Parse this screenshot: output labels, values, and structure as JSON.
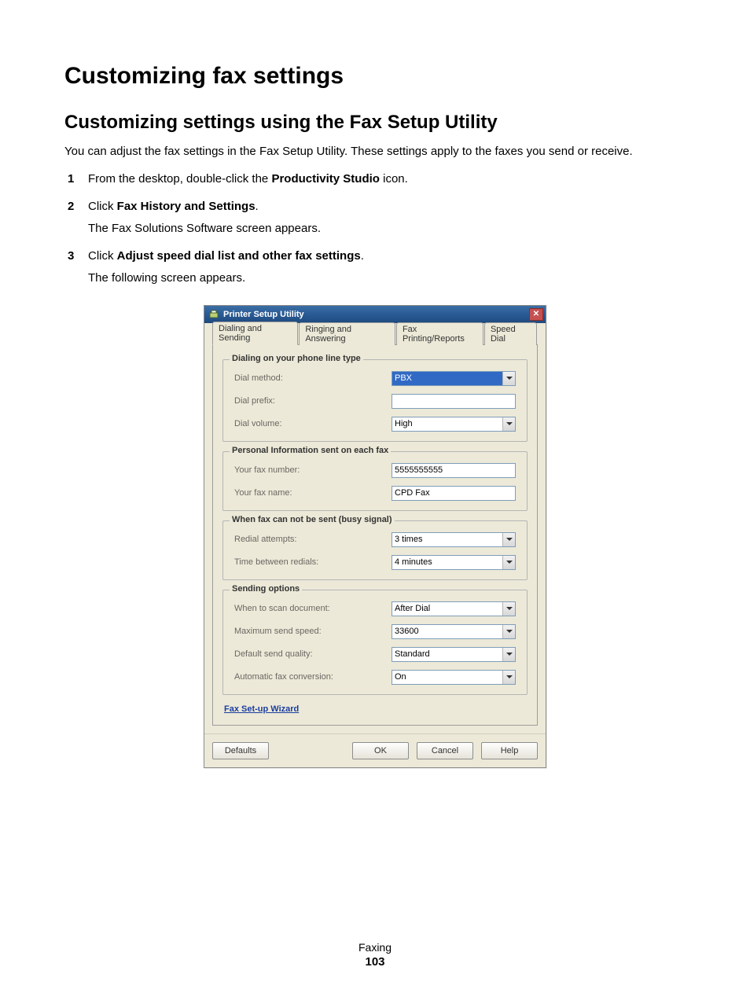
{
  "doc": {
    "heading": "Customizing fax settings",
    "subheading": "Customizing settings using the Fax Setup Utility",
    "intro": "You can adjust the fax settings in the Fax Setup Utility. These settings apply to the faxes you send or receive.",
    "steps": [
      {
        "num": "1",
        "pre": "From the desktop, double-click the ",
        "bold": "Productivity Studio",
        "post": " icon."
      },
      {
        "num": "2",
        "pre": "Click ",
        "bold": "Fax History and Settings",
        "post": ".",
        "sub": "The Fax Solutions Software screen appears."
      },
      {
        "num": "3",
        "pre": "Click ",
        "bold": "Adjust speed dial list and other fax settings",
        "post": ".",
        "sub": "The following screen appears."
      }
    ],
    "footer_label": "Faxing",
    "page_number": "103"
  },
  "dialog": {
    "title": "Printer Setup Utility",
    "tabs": [
      "Dialing and Sending",
      "Ringing and Answering",
      "Fax Printing/Reports",
      "Speed Dial"
    ],
    "groups": {
      "dialing": {
        "legend": "Dialing on your phone line type",
        "dial_method_label": "Dial method:",
        "dial_method_value": "PBX",
        "dial_prefix_label": "Dial prefix:",
        "dial_prefix_value": "",
        "dial_volume_label": "Dial volume:",
        "dial_volume_value": "High"
      },
      "personal": {
        "legend": "Personal Information sent on each fax",
        "fax_number_label": "Your fax number:",
        "fax_number_value": "5555555555",
        "fax_name_label": "Your fax name:",
        "fax_name_value": "CPD Fax"
      },
      "busy": {
        "legend": "When fax can not be sent (busy signal)",
        "redial_attempts_label": "Redial attempts:",
        "redial_attempts_value": "3 times",
        "time_between_label": "Time between redials:",
        "time_between_value": "4 minutes"
      },
      "sending": {
        "legend": "Sending options",
        "when_scan_label": "When to scan document:",
        "when_scan_value": "After Dial",
        "max_speed_label": "Maximum send speed:",
        "max_speed_value": "33600",
        "default_quality_label": "Default send quality:",
        "default_quality_value": "Standard",
        "auto_conv_label": "Automatic fax conversion:",
        "auto_conv_value": "On"
      }
    },
    "wizard_link": "Fax Set-up Wizard",
    "buttons": {
      "defaults": "Defaults",
      "ok": "OK",
      "cancel": "Cancel",
      "help": "Help"
    }
  }
}
